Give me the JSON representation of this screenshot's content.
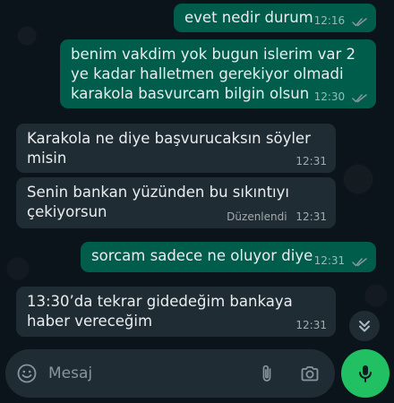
{
  "messages": [
    {
      "direction": "outgoing",
      "text": "evet nedir durum",
      "time": "12:16",
      "status": "read"
    },
    {
      "direction": "outgoing",
      "text": "benim vakdim yok bugun islerim var 2\nye kadar halletmen gerekiyor olmadi\nkarakola basvurcam bilgin olsun",
      "time": "12:30",
      "status": "read"
    },
    {
      "direction": "incoming",
      "text": "Karakola ne diye başvurucaksın söyler\nmisin",
      "time": "12:31"
    },
    {
      "direction": "incoming",
      "text": "Senin bankan yüzünden bu sıkıntıyı\nçekiyorsun",
      "time": "12:31",
      "edited_label": "Düzenlendi"
    },
    {
      "direction": "outgoing",
      "text": "sorcam sadece ne oluyor diye",
      "time": "12:31",
      "status": "read"
    },
    {
      "direction": "incoming",
      "text": "13:30’da tekrar gidedeğim bankaya\nhaber vereceğim",
      "time": "12:31"
    }
  ],
  "composer": {
    "placeholder": "Mesaj"
  },
  "icons": {
    "emoji": "emoji-icon",
    "attach": "paperclip-icon",
    "camera": "camera-icon",
    "mic": "microphone-icon",
    "scroll": "double-chevron-down-icon",
    "read_receipt": "double-check-icon"
  },
  "colors": {
    "background": "#0b141a",
    "outgoing_bubble": "#005c4b",
    "incoming_bubble": "#202c33",
    "accent": "#21c063",
    "read_check": "#8696a0"
  }
}
